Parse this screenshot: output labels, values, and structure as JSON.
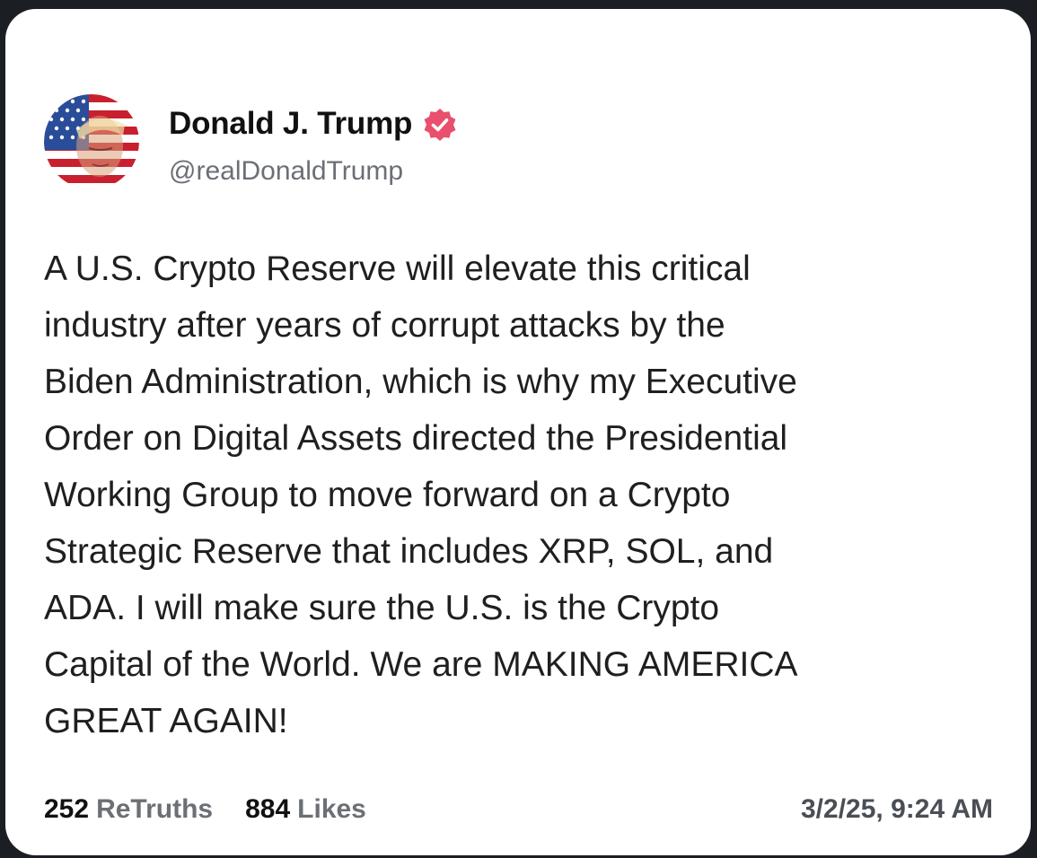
{
  "post": {
    "author_name": "Donald J. Trump",
    "handle": "@realDonaldTrump",
    "verified_icon": "verified-badge-icon",
    "text": "A U.S. Crypto Reserve will elevate this critical\nindustry after years of corrupt attacks by the\nBiden Administration, which is why my Executive\nOrder on Digital Assets directed the Presidential\nWorking Group to move forward on a Crypto\nStrategic Reserve that includes XRP, SOL, and\nADA. I will make sure the U.S. is the Crypto\nCapital of the World. We are MAKING AMERICA\nGREAT AGAIN!",
    "retruths_count": "252",
    "retruths_label": "ReTruths",
    "likes_count": "884",
    "likes_label": "Likes",
    "timestamp": "3/2/25, 9:24 AM"
  },
  "colors": {
    "verified_badge": "#e8506e",
    "card_background": "#ffffff",
    "page_background": "#1b1f24"
  }
}
